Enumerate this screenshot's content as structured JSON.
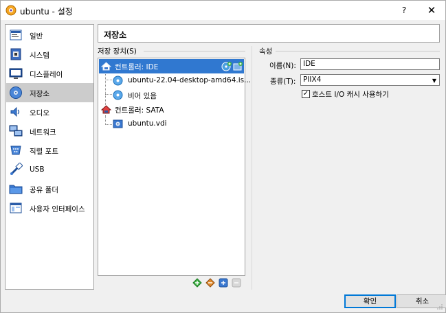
{
  "window": {
    "title": "ubuntu - 설정",
    "help_label": "?",
    "close_label": "✕"
  },
  "sidebar": {
    "items": [
      {
        "label": "일반",
        "icon": "general-icon"
      },
      {
        "label": "시스템",
        "icon": "system-icon"
      },
      {
        "label": "디스플레이",
        "icon": "display-icon"
      },
      {
        "label": "저장소",
        "icon": "storage-icon",
        "selected": true
      },
      {
        "label": "오디오",
        "icon": "audio-icon"
      },
      {
        "label": "네트워크",
        "icon": "network-icon"
      },
      {
        "label": "직렬 포트",
        "icon": "serial-port-icon"
      },
      {
        "label": "USB",
        "icon": "usb-icon"
      },
      {
        "label": "공유 폴더",
        "icon": "shared-folder-icon"
      },
      {
        "label": "사용자 인터페이스",
        "icon": "user-interface-icon"
      }
    ]
  },
  "header": {
    "title": "저장소"
  },
  "storage": {
    "group_label": "저장 장치(S)",
    "tree": [
      {
        "label": "컨트롤러: IDE",
        "type": "controller",
        "selected": true
      },
      {
        "label": "ubuntu-22.04-desktop-amd64.is...",
        "type": "optical"
      },
      {
        "label": "비어 있음",
        "type": "optical"
      },
      {
        "label": "컨트롤러: SATA",
        "type": "controller"
      },
      {
        "label": "ubuntu.vdi",
        "type": "disk"
      }
    ]
  },
  "properties": {
    "group_label": "속성",
    "name_label": "이름(N):",
    "name_value": "IDE",
    "type_label": "종류(T):",
    "type_value": "PIIX4",
    "cache_label": "호스트 I/O 캐시 사용하기",
    "cache_checked": true
  },
  "buttons": {
    "ok": "확인",
    "cancel": "취소"
  }
}
